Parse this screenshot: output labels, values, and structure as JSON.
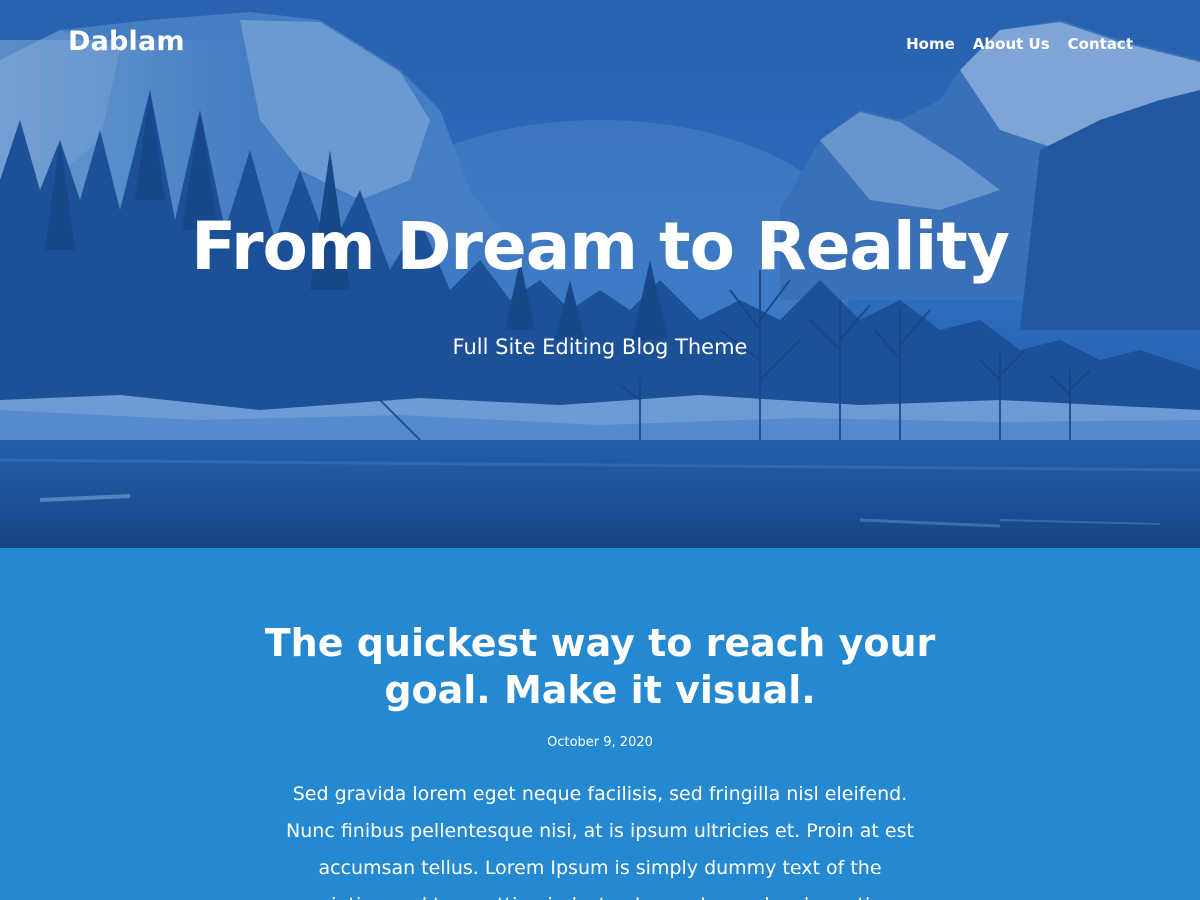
{
  "header": {
    "site_title": "Dablam",
    "nav": [
      {
        "label": "Home"
      },
      {
        "label": "About Us"
      },
      {
        "label": "Contact"
      }
    ]
  },
  "hero": {
    "title": "From Dream to Reality",
    "subtitle": "Full Site Editing Blog Theme"
  },
  "post": {
    "title": "The quickest way to reach your goal. Make it visual.",
    "date": "October 9, 2020",
    "excerpt": "Sed gravida lorem eget neque facilisis, sed fringilla nisl eleifend. Nunc finibus pellentesque nisi, at is ipsum ultricies et. Proin at est accumsan tellus. Lorem Ipsum is simply dummy text of the printing and typesetting industry. Lorem Ipsum has been the"
  },
  "colors": {
    "content_bg": "#2589d2",
    "hero_tint": "#1f5fae",
    "text": "#ffffff"
  }
}
